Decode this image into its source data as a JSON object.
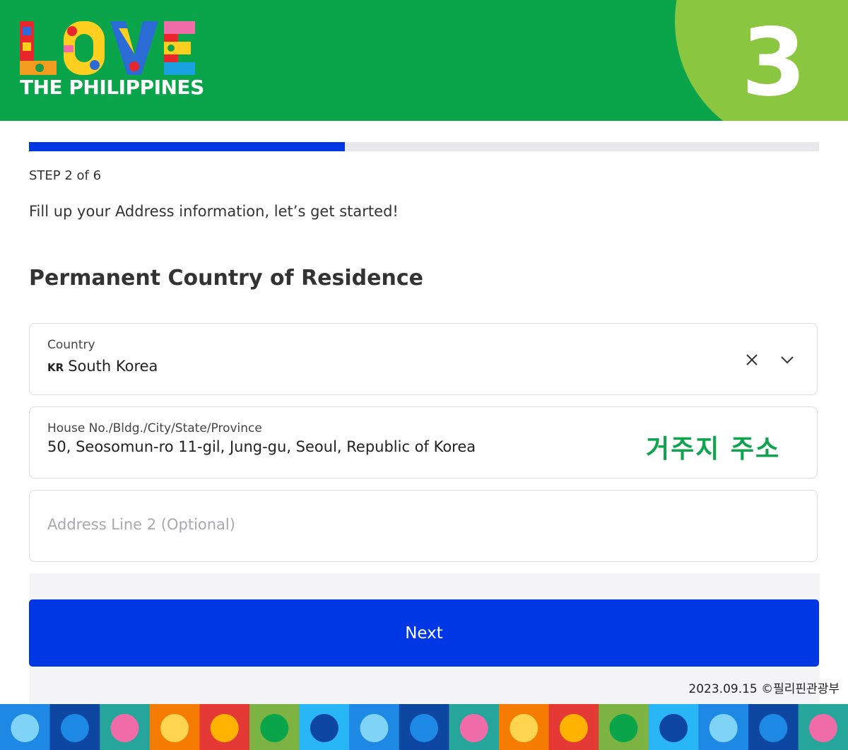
{
  "brand": {
    "logo_word": "LOVE",
    "logo_subtitle": "THE PHILIPPINES",
    "step_badge": "3",
    "colors": {
      "header_green": "#0aa54a",
      "badge_green": "#8ac63f",
      "primary_blue": "#0037e5",
      "annotation_green": "#10a450"
    }
  },
  "progress": {
    "current_step": 2,
    "total_steps": 6,
    "fraction": 0.4
  },
  "step_label": "STEP 2 of 6",
  "intro_text": "Fill up your Address information, let’s get started!",
  "section_title": "Permanent Country of Residence",
  "form": {
    "country": {
      "label": "Country",
      "flag_code": "KR",
      "value": "South Korea",
      "clear_icon": "close-icon",
      "dropdown_icon": "chevron-down-icon"
    },
    "address1": {
      "label": "House No./Bldg./City/State/Province",
      "value": "50, Seosomun-ro 11-gil, Jung-gu, Seoul, Republic of Korea"
    },
    "address2": {
      "placeholder": "Address Line 2 (Optional)"
    },
    "annotation": "거주지 주소"
  },
  "next_label": "Next",
  "footer_note": "2023.09.15 ©필리핀관광부"
}
